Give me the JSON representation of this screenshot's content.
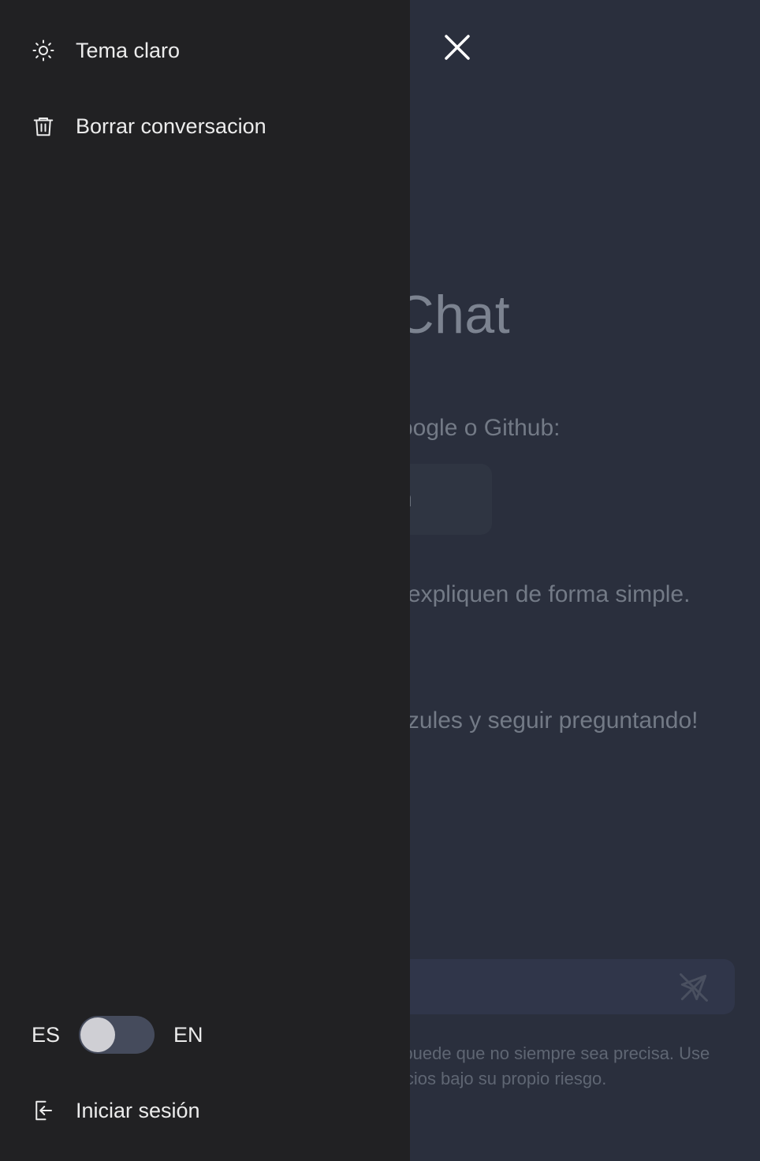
{
  "main": {
    "title": "AI Chat",
    "signin_hint": "Inicia sesión con Google o Github:",
    "signin_button": "Sign in",
    "paragraph_1": "Pregunta cosas y pide que te expliquen de forma simple.",
    "paragraph_2": "¡Puedes pulsar las palabras azules y seguir preguntando!",
    "disclaimer": "Esta aplicación usa inteligencia artificial y puede que no siempre sea precisa. Use nuestra aplicación y los servicios bajo su propio riesgo."
  },
  "drawer": {
    "theme_label": "Tema claro",
    "clear_label": "Borrar conversacion",
    "lang_left": "ES",
    "lang_right": "EN",
    "login_label": "Iniciar sesión"
  },
  "icons": {
    "theme": "sun-icon",
    "clear": "trash-icon",
    "login": "login-icon",
    "close": "close-icon",
    "send": "send-icon"
  },
  "colors": {
    "drawer_bg": "#212123",
    "main_bg": "#2a2f3d",
    "text": "#ececec"
  }
}
